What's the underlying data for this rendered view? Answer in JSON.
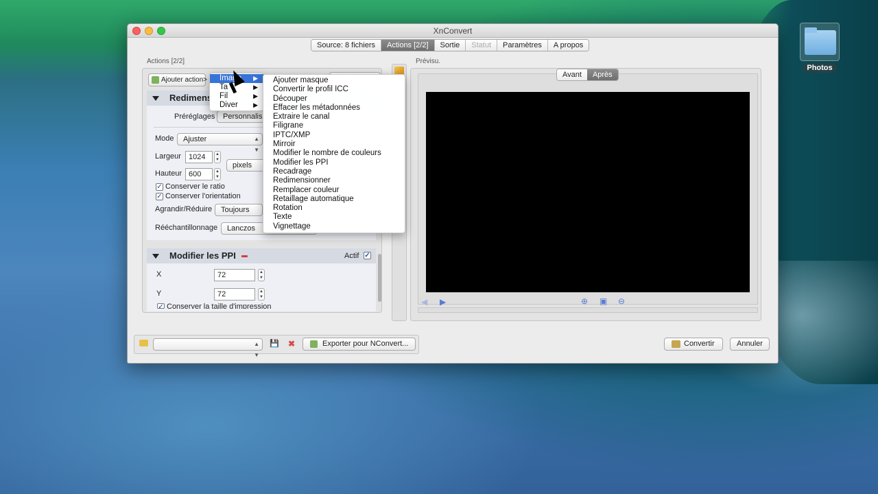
{
  "window": {
    "title": "XnConvert"
  },
  "tabs": [
    {
      "label": "Source: 8 fichiers",
      "state": "normal"
    },
    {
      "label": "Actions [2/2]",
      "state": "active"
    },
    {
      "label": "Sortie",
      "state": "normal"
    },
    {
      "label": "Statut",
      "state": "disabled"
    },
    {
      "label": "Paramètres",
      "state": "normal"
    },
    {
      "label": "A propos",
      "state": "normal"
    }
  ],
  "desktop": {
    "folder_label": "Photos"
  },
  "actions": {
    "group_label": "Actions [2/2]",
    "add_action_label": "Ajouter action>",
    "resize": {
      "title": "Redimens",
      "presets_label": "Préréglages",
      "presets_value": "Personnalisé",
      "mode_label": "Mode",
      "mode_value": "Ajuster",
      "width_label": "Largeur",
      "width_value": "1024",
      "height_label": "Hauteur",
      "height_value": "600",
      "unit_value": "pixels",
      "keep_ratio_label": "Conserver le ratio",
      "keep_orientation_label": "Conserver l'orientation",
      "enlarge_label": "Agrandir/Réduire",
      "enlarge_value": "Toujours",
      "resample_label": "Rééchantillonnage",
      "resample_value": "Lanczos"
    },
    "ppi": {
      "title": "Modifier les PPI",
      "active_label": "Actif",
      "x_label": "X",
      "x_value": "72",
      "y_label": "Y",
      "y_value": "72",
      "keep_print_label": "Conserver la taille d'impression"
    }
  },
  "preview": {
    "group_label": "Prévisu.",
    "before_label": "Avant",
    "after_label": "Après"
  },
  "bottom": {
    "export_label": "Exporter pour NConvert...",
    "convert_label": "Convertir",
    "cancel_label": "Annuler"
  },
  "menu_categories": [
    {
      "label": "Image",
      "highlighted": true
    },
    {
      "label": "Ta",
      "highlighted": false
    },
    {
      "label": "Fil",
      "highlighted": false
    },
    {
      "label": "Diver",
      "highlighted": false
    }
  ],
  "image_submenu": [
    "Ajouter masque",
    "Convertir le profil ICC",
    "Découper",
    "Effacer les métadonnées",
    "Extraire le canal",
    "Filigrane",
    "IPTC/XMP",
    "Mirroir",
    "Modifier le nombre de couleurs",
    "Modifier les PPI",
    "Recadrage",
    "Redimensionner",
    "Remplacer couleur",
    "Retaillage automatique",
    "Rotation",
    "Texte",
    "Vignettage"
  ],
  "colors": {
    "accent": "#3874d8",
    "active_tab": "#7a7a7a",
    "section_header": "#d5dae3"
  }
}
